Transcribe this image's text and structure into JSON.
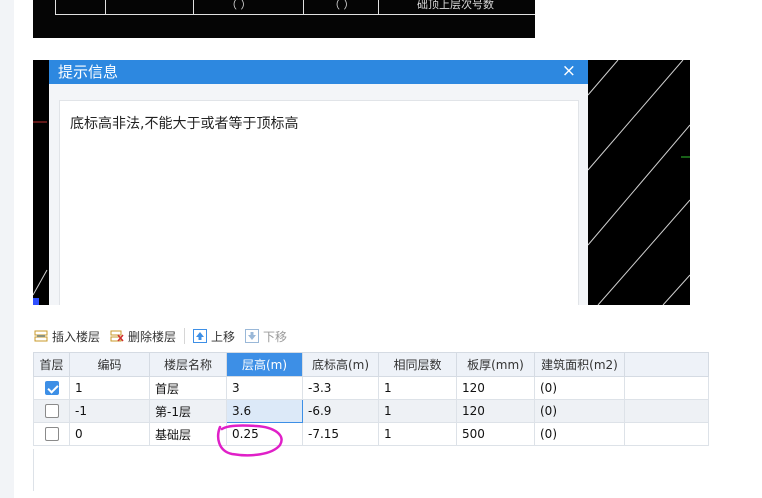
{
  "top_cad": {
    "col1": "（ ）",
    "col2": "（ ）",
    "col3": "础顶上层次号数"
  },
  "dialog": {
    "title": "提示信息",
    "close": "×",
    "message": "底标高非法,不能大于或者等于顶标高"
  },
  "toolbar": {
    "insert": "插入楼层",
    "delete": "删除楼层",
    "move_up": "上移",
    "move_down": "下移"
  },
  "table": {
    "headers": [
      "首层",
      "编码",
      "楼层名称",
      "层高(m)",
      "底标高(m)",
      "相同层数",
      "板厚(mm)",
      "建筑面积(m2)"
    ],
    "rows": [
      {
        "checked": true,
        "code": "1",
        "name": "首层",
        "height": "3",
        "bottom": "-3.3",
        "same": "1",
        "thick": "120",
        "area": "(0)"
      },
      {
        "checked": false,
        "code": "-1",
        "name": "第-1层",
        "height": "3.6",
        "bottom": "-6.9",
        "same": "1",
        "thick": "120",
        "area": "(0)"
      },
      {
        "checked": false,
        "code": "0",
        "name": "基础层",
        "height": "0.25",
        "bottom": "-7.15",
        "same": "1",
        "thick": "500",
        "area": "(0)"
      }
    ]
  },
  "colors": {
    "accent": "#3d8fe6",
    "dialog_title": "#2d88e0",
    "annotation": "#e020c8"
  }
}
